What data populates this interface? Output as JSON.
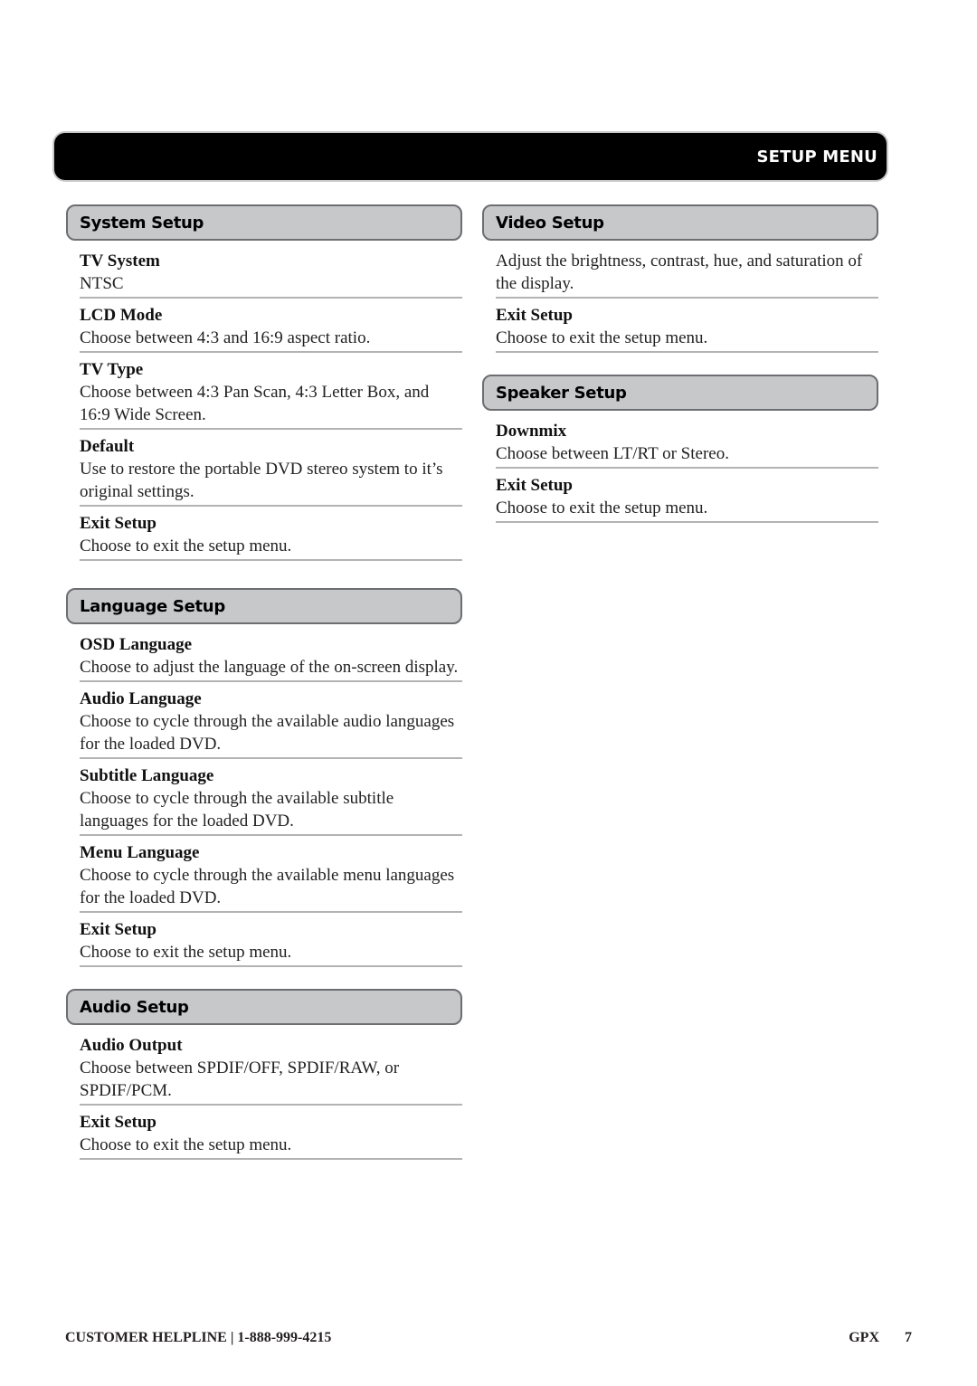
{
  "banner": {
    "title": "SETUP MENU"
  },
  "sections": {
    "system": {
      "title": "System Setup",
      "items": [
        {
          "title": "TV System",
          "desc": "NTSC"
        },
        {
          "title": "LCD Mode",
          "desc": "Choose between 4:3 and 16:9 aspect ratio."
        },
        {
          "title": "TV Type",
          "desc": "Choose between 4:3 Pan Scan, 4:3 Letter Box, and 16:9 Wide Screen."
        },
        {
          "title": "Default",
          "desc": "Use to restore the portable DVD stereo system to it’s original settings."
        },
        {
          "title": "Exit Setup",
          "desc": "Choose to exit the setup menu."
        }
      ]
    },
    "language": {
      "title": "Language Setup",
      "items": [
        {
          "title": "OSD Language",
          "desc": "Choose to adjust the language of the on-screen display."
        },
        {
          "title": "Audio Language",
          "desc": "Choose to cycle through the available audio languages for the loaded DVD."
        },
        {
          "title": "Subtitle Language",
          "desc": "Choose to cycle through the available subtitle languages for the loaded DVD."
        },
        {
          "title": "Menu Language",
          "desc": "Choose to cycle through the available menu languages for the loaded DVD."
        },
        {
          "title": "Exit Setup",
          "desc": "Choose to exit the setup menu."
        }
      ]
    },
    "audio": {
      "title": "Audio Setup",
      "items": [
        {
          "title": "Audio Output",
          "desc": "Choose between SPDIF/OFF, SPDIF/RAW, or SPDIF/PCM."
        },
        {
          "title": "Exit Setup",
          "desc": "Choose to exit the setup menu."
        }
      ]
    },
    "video": {
      "title": "Video Setup",
      "items": [
        {
          "title": "",
          "desc": "Adjust the brightness, contrast, hue, and saturation of the display."
        },
        {
          "title": "Exit Setup",
          "desc": "Choose to exit the setup menu."
        }
      ]
    },
    "speaker": {
      "title": "Speaker Setup",
      "items": [
        {
          "title": "Downmix",
          "desc": "Choose between LT/RT or Stereo."
        },
        {
          "title": "Exit Setup",
          "desc": "Choose to exit the setup menu."
        }
      ]
    }
  },
  "footer": {
    "helpline": "CUSTOMER HELPLINE  |  1-888-999-4215",
    "brand": "GPX",
    "page": "7"
  }
}
